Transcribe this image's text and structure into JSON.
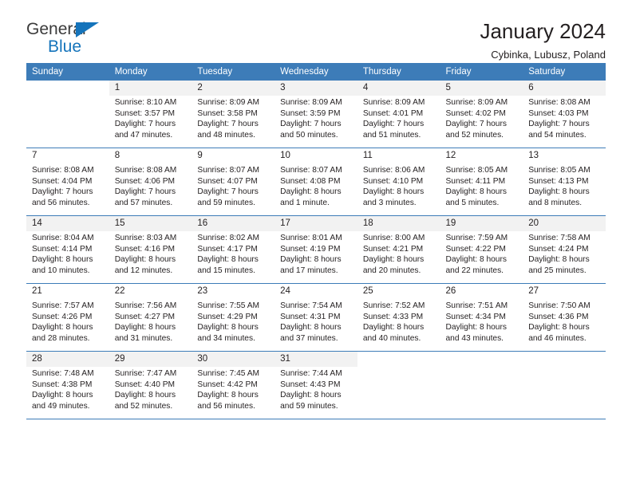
{
  "brand": {
    "name_top": "General",
    "name_bottom": "Blue"
  },
  "header": {
    "title": "January 2024",
    "subtitle": "Cybinka, Lubusz, Poland"
  },
  "colors": {
    "header_blue": "#3D7CB8",
    "brand_blue": "#1574BB",
    "shade_gray": "#F2F2F2",
    "text": "#231F20"
  },
  "weekdays": [
    "Sunday",
    "Monday",
    "Tuesday",
    "Wednesday",
    "Thursday",
    "Friday",
    "Saturday"
  ],
  "weeks": [
    [
      {
        "day": "",
        "sunrise": "",
        "sunset": "",
        "daylight_1": "",
        "daylight_2": "",
        "empty": true
      },
      {
        "day": "1",
        "sunrise": "Sunrise: 8:10 AM",
        "sunset": "Sunset: 3:57 PM",
        "daylight_1": "Daylight: 7 hours",
        "daylight_2": "and 47 minutes."
      },
      {
        "day": "2",
        "sunrise": "Sunrise: 8:09 AM",
        "sunset": "Sunset: 3:58 PM",
        "daylight_1": "Daylight: 7 hours",
        "daylight_2": "and 48 minutes."
      },
      {
        "day": "3",
        "sunrise": "Sunrise: 8:09 AM",
        "sunset": "Sunset: 3:59 PM",
        "daylight_1": "Daylight: 7 hours",
        "daylight_2": "and 50 minutes."
      },
      {
        "day": "4",
        "sunrise": "Sunrise: 8:09 AM",
        "sunset": "Sunset: 4:01 PM",
        "daylight_1": "Daylight: 7 hours",
        "daylight_2": "and 51 minutes."
      },
      {
        "day": "5",
        "sunrise": "Sunrise: 8:09 AM",
        "sunset": "Sunset: 4:02 PM",
        "daylight_1": "Daylight: 7 hours",
        "daylight_2": "and 52 minutes."
      },
      {
        "day": "6",
        "sunrise": "Sunrise: 8:08 AM",
        "sunset": "Sunset: 4:03 PM",
        "daylight_1": "Daylight: 7 hours",
        "daylight_2": "and 54 minutes."
      }
    ],
    [
      {
        "day": "7",
        "sunrise": "Sunrise: 8:08 AM",
        "sunset": "Sunset: 4:04 PM",
        "daylight_1": "Daylight: 7 hours",
        "daylight_2": "and 56 minutes."
      },
      {
        "day": "8",
        "sunrise": "Sunrise: 8:08 AM",
        "sunset": "Sunset: 4:06 PM",
        "daylight_1": "Daylight: 7 hours",
        "daylight_2": "and 57 minutes."
      },
      {
        "day": "9",
        "sunrise": "Sunrise: 8:07 AM",
        "sunset": "Sunset: 4:07 PM",
        "daylight_1": "Daylight: 7 hours",
        "daylight_2": "and 59 minutes."
      },
      {
        "day": "10",
        "sunrise": "Sunrise: 8:07 AM",
        "sunset": "Sunset: 4:08 PM",
        "daylight_1": "Daylight: 8 hours",
        "daylight_2": "and 1 minute."
      },
      {
        "day": "11",
        "sunrise": "Sunrise: 8:06 AM",
        "sunset": "Sunset: 4:10 PM",
        "daylight_1": "Daylight: 8 hours",
        "daylight_2": "and 3 minutes."
      },
      {
        "day": "12",
        "sunrise": "Sunrise: 8:05 AM",
        "sunset": "Sunset: 4:11 PM",
        "daylight_1": "Daylight: 8 hours",
        "daylight_2": "and 5 minutes."
      },
      {
        "day": "13",
        "sunrise": "Sunrise: 8:05 AM",
        "sunset": "Sunset: 4:13 PM",
        "daylight_1": "Daylight: 8 hours",
        "daylight_2": "and 8 minutes."
      }
    ],
    [
      {
        "day": "14",
        "sunrise": "Sunrise: 8:04 AM",
        "sunset": "Sunset: 4:14 PM",
        "daylight_1": "Daylight: 8 hours",
        "daylight_2": "and 10 minutes."
      },
      {
        "day": "15",
        "sunrise": "Sunrise: 8:03 AM",
        "sunset": "Sunset: 4:16 PM",
        "daylight_1": "Daylight: 8 hours",
        "daylight_2": "and 12 minutes."
      },
      {
        "day": "16",
        "sunrise": "Sunrise: 8:02 AM",
        "sunset": "Sunset: 4:17 PM",
        "daylight_1": "Daylight: 8 hours",
        "daylight_2": "and 15 minutes."
      },
      {
        "day": "17",
        "sunrise": "Sunrise: 8:01 AM",
        "sunset": "Sunset: 4:19 PM",
        "daylight_1": "Daylight: 8 hours",
        "daylight_2": "and 17 minutes."
      },
      {
        "day": "18",
        "sunrise": "Sunrise: 8:00 AM",
        "sunset": "Sunset: 4:21 PM",
        "daylight_1": "Daylight: 8 hours",
        "daylight_2": "and 20 minutes."
      },
      {
        "day": "19",
        "sunrise": "Sunrise: 7:59 AM",
        "sunset": "Sunset: 4:22 PM",
        "daylight_1": "Daylight: 8 hours",
        "daylight_2": "and 22 minutes."
      },
      {
        "day": "20",
        "sunrise": "Sunrise: 7:58 AM",
        "sunset": "Sunset: 4:24 PM",
        "daylight_1": "Daylight: 8 hours",
        "daylight_2": "and 25 minutes."
      }
    ],
    [
      {
        "day": "21",
        "sunrise": "Sunrise: 7:57 AM",
        "sunset": "Sunset: 4:26 PM",
        "daylight_1": "Daylight: 8 hours",
        "daylight_2": "and 28 minutes."
      },
      {
        "day": "22",
        "sunrise": "Sunrise: 7:56 AM",
        "sunset": "Sunset: 4:27 PM",
        "daylight_1": "Daylight: 8 hours",
        "daylight_2": "and 31 minutes."
      },
      {
        "day": "23",
        "sunrise": "Sunrise: 7:55 AM",
        "sunset": "Sunset: 4:29 PM",
        "daylight_1": "Daylight: 8 hours",
        "daylight_2": "and 34 minutes."
      },
      {
        "day": "24",
        "sunrise": "Sunrise: 7:54 AM",
        "sunset": "Sunset: 4:31 PM",
        "daylight_1": "Daylight: 8 hours",
        "daylight_2": "and 37 minutes."
      },
      {
        "day": "25",
        "sunrise": "Sunrise: 7:52 AM",
        "sunset": "Sunset: 4:33 PM",
        "daylight_1": "Daylight: 8 hours",
        "daylight_2": "and 40 minutes."
      },
      {
        "day": "26",
        "sunrise": "Sunrise: 7:51 AM",
        "sunset": "Sunset: 4:34 PM",
        "daylight_1": "Daylight: 8 hours",
        "daylight_2": "and 43 minutes."
      },
      {
        "day": "27",
        "sunrise": "Sunrise: 7:50 AM",
        "sunset": "Sunset: 4:36 PM",
        "daylight_1": "Daylight: 8 hours",
        "daylight_2": "and 46 minutes."
      }
    ],
    [
      {
        "day": "28",
        "sunrise": "Sunrise: 7:48 AM",
        "sunset": "Sunset: 4:38 PM",
        "daylight_1": "Daylight: 8 hours",
        "daylight_2": "and 49 minutes."
      },
      {
        "day": "29",
        "sunrise": "Sunrise: 7:47 AM",
        "sunset": "Sunset: 4:40 PM",
        "daylight_1": "Daylight: 8 hours",
        "daylight_2": "and 52 minutes."
      },
      {
        "day": "30",
        "sunrise": "Sunrise: 7:45 AM",
        "sunset": "Sunset: 4:42 PM",
        "daylight_1": "Daylight: 8 hours",
        "daylight_2": "and 56 minutes."
      },
      {
        "day": "31",
        "sunrise": "Sunrise: 7:44 AM",
        "sunset": "Sunset: 4:43 PM",
        "daylight_1": "Daylight: 8 hours",
        "daylight_2": "and 59 minutes."
      },
      {
        "day": "",
        "sunrise": "",
        "sunset": "",
        "daylight_1": "",
        "daylight_2": "",
        "empty": true
      },
      {
        "day": "",
        "sunrise": "",
        "sunset": "",
        "daylight_1": "",
        "daylight_2": "",
        "empty": true
      },
      {
        "day": "",
        "sunrise": "",
        "sunset": "",
        "daylight_1": "",
        "daylight_2": "",
        "empty": true
      }
    ]
  ]
}
